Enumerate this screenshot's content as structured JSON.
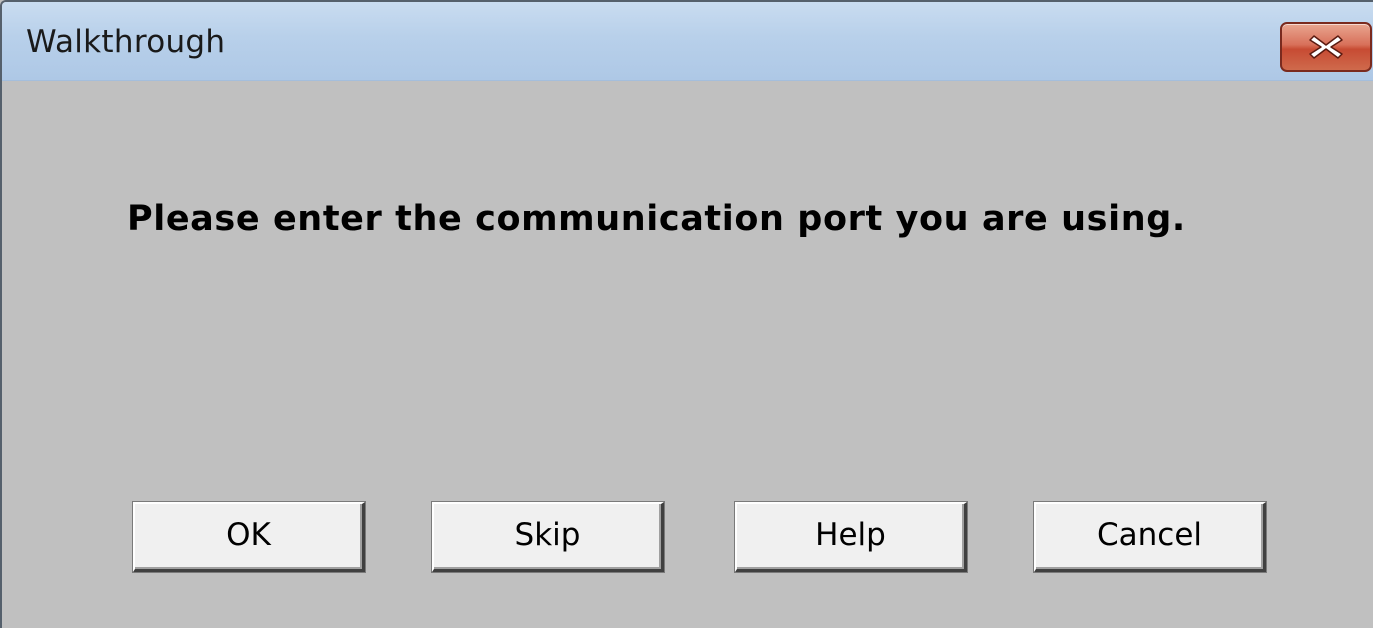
{
  "window": {
    "title": "Walkthrough"
  },
  "title_bar": {
    "close_icon": "close-x-icon",
    "close_color": "#c74b33"
  },
  "dialog": {
    "message": "Please enter the communication port you are using."
  },
  "buttons": {
    "ok_label": "OK",
    "skip_label": "Skip",
    "help_label": "Help",
    "cancel_label": "Cancel"
  },
  "colors": {
    "background": "#c0c0c0",
    "title_bar": "#b8d0ea",
    "button_face": "#f0f0f0"
  }
}
